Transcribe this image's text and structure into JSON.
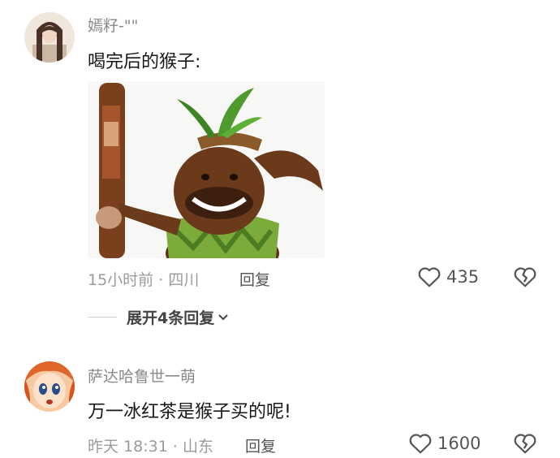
{
  "comments": [
    {
      "username": "嫣籽-\"\"",
      "text": "喝完后的猴子:",
      "time": "15小时前",
      "location": "四川",
      "reply_label": "回复",
      "likes": "435",
      "sticker_icon": "monkey-meme-sticker"
    },
    {
      "username": "萨达哈鲁世一萌",
      "text": "万一冰红茶是猴子买的呢!",
      "time": "昨天 18:31",
      "location": "山东",
      "reply_label": "回复",
      "likes": "1600"
    }
  ],
  "expand_replies": {
    "label": "展开4条回复"
  },
  "colors": {
    "text": "#161616",
    "meta": "#9b9b9b",
    "username": "#8a8a8a",
    "icon": "#555555"
  }
}
